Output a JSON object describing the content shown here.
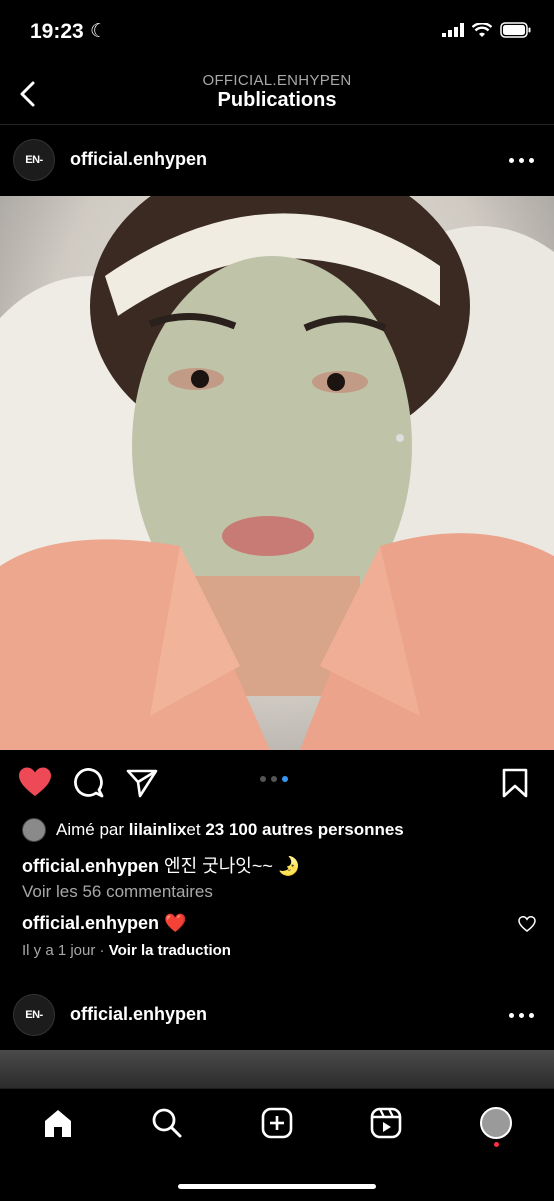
{
  "status": {
    "time": "19:23"
  },
  "header": {
    "subtitle": "OFFICIAL.ENHYPEN",
    "title": "Publications"
  },
  "post1": {
    "avatar_text": "EN-",
    "username": "official.enhypen",
    "liked": true,
    "carousel": {
      "count": 3,
      "active": 3
    },
    "likes": {
      "prefix": "Aimé par ",
      "user": "lilainlix",
      "mid": " et ",
      "count": "23 100 autres personnes"
    },
    "caption": {
      "user": "official.enhypen",
      "text": " 엔진 굿나잇~~ 🌛"
    },
    "view_comments": "Voir les 56 commentaires",
    "comment": {
      "user": "official.enhypen",
      "text": " ❤️"
    },
    "time_ago": "Il y a 1 jour",
    "separator": " · ",
    "translate": "Voir la traduction"
  },
  "post2": {
    "avatar_text": "EN-",
    "username": "official.enhypen"
  },
  "colors": {
    "like_red": "#ed4956",
    "accent_blue": "#3897f0",
    "notification": "#ff3040"
  },
  "nav": {
    "items": [
      "home-icon",
      "search-icon",
      "create-icon",
      "reels-icon",
      "profile-avatar"
    ]
  }
}
